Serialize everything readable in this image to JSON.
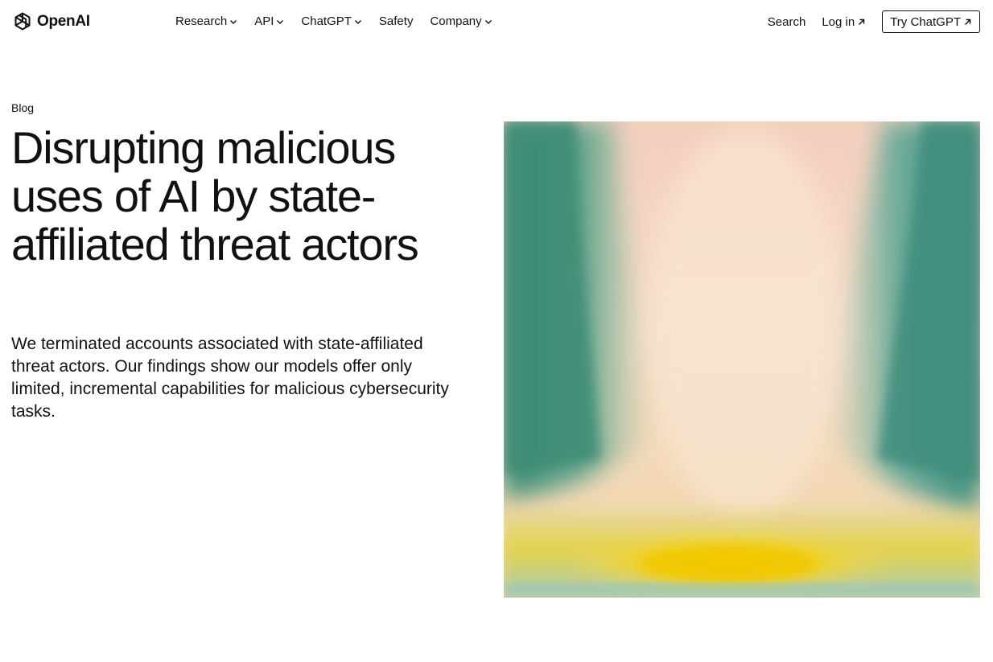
{
  "brand": {
    "name": "OpenAI",
    "logo_icon": "openai-knot-icon"
  },
  "nav": {
    "items": [
      {
        "label": "Research",
        "has_dropdown": true
      },
      {
        "label": "API",
        "has_dropdown": true
      },
      {
        "label": "ChatGPT",
        "has_dropdown": true
      },
      {
        "label": "Safety",
        "has_dropdown": false
      },
      {
        "label": "Company",
        "has_dropdown": true
      }
    ],
    "search_label": "Search",
    "login_label": "Log in",
    "cta_label": "Try ChatGPT"
  },
  "article": {
    "category": "Blog",
    "title": "Disrupting malicious uses of AI by state-affiliated threat actors",
    "summary": "We terminated accounts associated with state-affiliated threat actors. Our findings show our models offer only limited, incremental capabilities for malicious cybersecurity tasks."
  },
  "colors": {
    "text": "#111111",
    "background": "#ffffff",
    "hero_green": "#4f9a86",
    "hero_peach": "#f3d7c6",
    "hero_yellow": "#f0d21a"
  }
}
